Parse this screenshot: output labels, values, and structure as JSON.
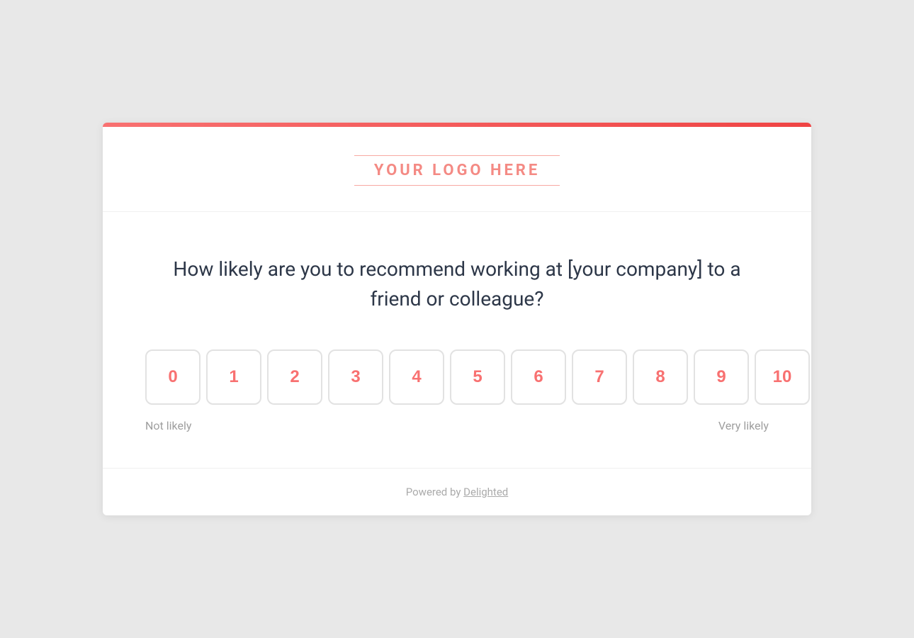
{
  "card": {
    "top_bar_color": "#ef4444"
  },
  "logo": {
    "text": "YOUR LOGO HERE"
  },
  "survey": {
    "question": "How likely are you to recommend working at [your company] to a friend or colleague?",
    "scale": {
      "min_label": "Not likely",
      "max_label": "Very likely",
      "values": [
        "0",
        "1",
        "2",
        "3",
        "4",
        "5",
        "6",
        "7",
        "8",
        "9",
        "10"
      ]
    }
  },
  "footer": {
    "powered_by_text": "Powered by ",
    "powered_by_link": "Delighted"
  }
}
